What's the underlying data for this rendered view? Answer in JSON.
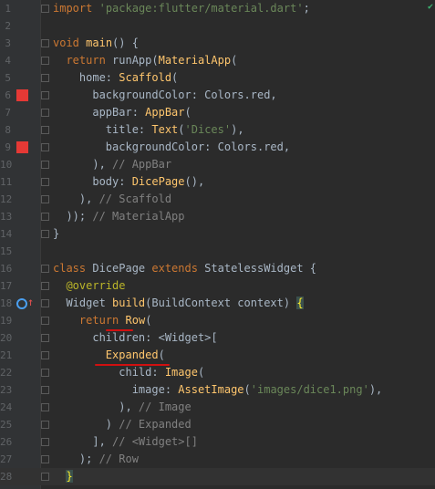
{
  "editor": {
    "lines": [
      {
        "n": "1",
        "html": "<span class=\"kw\">import</span> <span class=\"str\">'package:flutter/material.dart'</span>;"
      },
      {
        "n": "2",
        "html": ""
      },
      {
        "n": "3",
        "html": "<span class=\"kw\">void</span> <span class=\"cls\">main</span>() {"
      },
      {
        "n": "4",
        "html": "  <span class=\"kw\">return</span> runApp(<span class=\"cls\">MaterialApp</span>("
      },
      {
        "n": "5",
        "html": "    home: <span class=\"cls\">Scaffold</span>("
      },
      {
        "n": "6",
        "html": "      backgroundColor: Colors.red,"
      },
      {
        "n": "7",
        "html": "      appBar: <span class=\"cls\">AppBar</span>("
      },
      {
        "n": "8",
        "html": "        title: <span class=\"cls\">Text</span>(<span class=\"str\">'Dices'</span>),"
      },
      {
        "n": "9",
        "html": "        backgroundColor: Colors.red,"
      },
      {
        "n": "10",
        "html": "      ), <span class=\"cm\">// AppBar</span>"
      },
      {
        "n": "11",
        "html": "      body: <span class=\"cls\">DicePage</span>(),"
      },
      {
        "n": "12",
        "html": "    ), <span class=\"cm\">// Scaffold</span>"
      },
      {
        "n": "13",
        "html": "  )); <span class=\"cm\">// MaterialApp</span>"
      },
      {
        "n": "14",
        "html": "}"
      },
      {
        "n": "15",
        "html": ""
      },
      {
        "n": "16",
        "html": "<span class=\"kw\">class</span> DicePage <span class=\"kw\">extends</span> StatelessWidget {"
      },
      {
        "n": "17",
        "html": "  <span class=\"ann\">@override</span>"
      },
      {
        "n": "18",
        "html": "  Widget <span class=\"cls\">build</span>(BuildContext context) <span class=\"hl\">{</span>"
      },
      {
        "n": "19",
        "html": "    <span class=\"kw\">return</span> <span class=\"cls\">Row</span>("
      },
      {
        "n": "20",
        "html": "      children: &lt;Widget&gt;["
      },
      {
        "n": "21",
        "html": "        <span class=\"cls\">Expanded</span>("
      },
      {
        "n": "22",
        "html": "          child: <span class=\"cls\">Image</span>("
      },
      {
        "n": "23",
        "html": "            image: <span class=\"cls\">AssetImage</span>(<span class=\"str\">'images/dice1.png'</span>),"
      },
      {
        "n": "24",
        "html": "          ), <span class=\"cm\">// Image</span>"
      },
      {
        "n": "25",
        "html": "        ) <span class=\"cm\">// Expanded</span>"
      },
      {
        "n": "26",
        "html": "      ], <span class=\"cm\">// &lt;Widget&gt;[]</span>"
      },
      {
        "n": "27",
        "html": "    ); <span class=\"cm\">// Row</span>"
      },
      {
        "n": "28",
        "html": "  <span class=\"hl\">}</span>"
      }
    ],
    "color_markers_lines": [
      "6",
      "9"
    ],
    "override_marker_line": "18",
    "current_line": "28",
    "colors": {
      "background": "#2b2b2b",
      "gutter": "#313335",
      "keyword": "#cc7832",
      "string": "#6a8759",
      "function": "#ffc66d",
      "comment": "#808080",
      "marker": "#e53935"
    }
  }
}
